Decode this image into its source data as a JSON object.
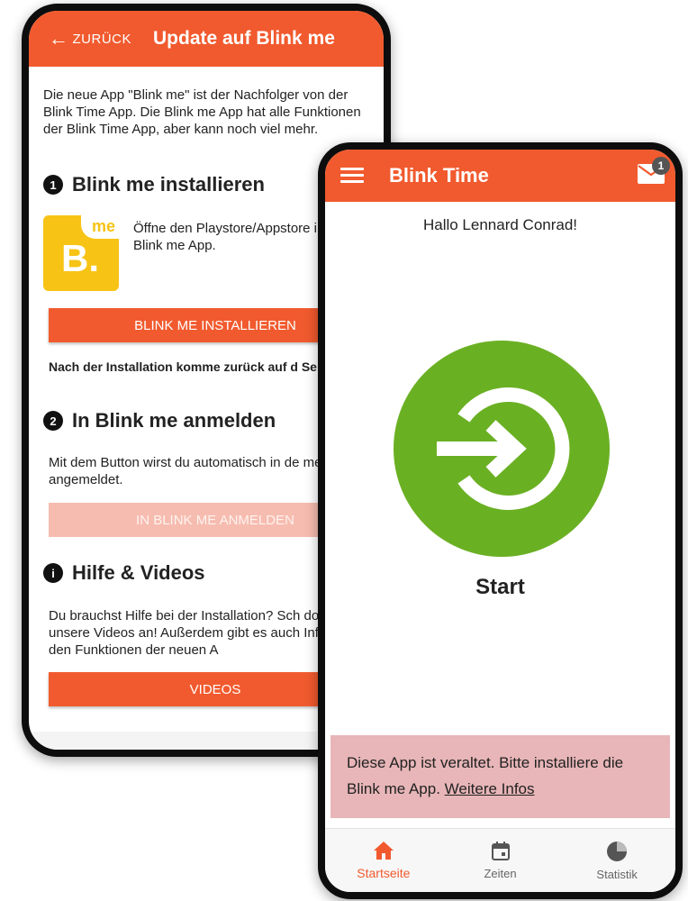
{
  "colors": {
    "accent": "#f15a2e",
    "start_green": "#6ab023",
    "warning_bg": "#e8b6b8",
    "logo_yellow": "#f7c315"
  },
  "update_screen": {
    "back_label": "ZURÜCK",
    "title": "Update auf Blink me",
    "intro": "Die neue App \"Blink me\" ist der Nachfolger von der Blink Time App. Die Blink me App hat alle Funktionen der Blink Time App, aber kann noch viel mehr.",
    "step1": {
      "number": "1",
      "heading": "Blink me installieren",
      "logo_letter": "B.",
      "logo_me": "me",
      "description": "Öffne den Playstore/Appstore installiere die Blink me App.",
      "button_label": "BLINK ME INSTALLIEREN"
    },
    "note": "Nach der Installation komme zurück auf d Seite!",
    "step2": {
      "number": "2",
      "heading": "In Blink me anmelden",
      "description": "Mit dem Button wirst du automatisch in de me App angemeldet.",
      "button_label": "IN BLINK ME ANMELDEN"
    },
    "help": {
      "icon": "info-icon",
      "heading": "Hilfe & Videos",
      "description": "Du brauchst Hilfe bei der Installation? Sch doch unsere Videos an! Außerdem gibt es auch Infos zu den Funktionen der neuen A",
      "button_label": "VIDEOS"
    }
  },
  "main_screen": {
    "title": "Blink Time",
    "mail_badge": "1",
    "greeting": "Hallo Lennard Conrad!",
    "start_label": "Start",
    "warning_text": "Diese App ist veraltet. Bitte installiere die Blink me App. ",
    "warning_link": "Weitere Infos",
    "nav": [
      {
        "label": "Startseite",
        "icon": "home-icon",
        "active": true
      },
      {
        "label": "Zeiten",
        "icon": "calendar-icon",
        "active": false
      },
      {
        "label": "Statistik",
        "icon": "pie-chart-icon",
        "active": false
      }
    ]
  }
}
